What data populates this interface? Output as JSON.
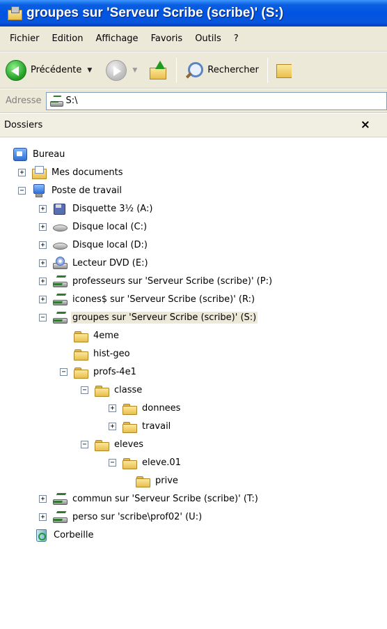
{
  "window": {
    "title": "groupes sur 'Serveur Scribe (scribe)' (S:)"
  },
  "menu": [
    "Fichier",
    "Edition",
    "Affichage",
    "Favoris",
    "Outils",
    "?"
  ],
  "toolbar": {
    "back_label": "Précédente",
    "search_label": "Rechercher"
  },
  "address": {
    "label": "Adresse",
    "value": "S:\\"
  },
  "folders_pane": {
    "title": "Dossiers",
    "close_glyph": "×"
  },
  "tree": [
    {
      "label": "Bureau",
      "icon": "desktop-icon",
      "expander": ""
    },
    {
      "label": "Mes documents",
      "icon": "my-documents-icon",
      "expander": "+"
    },
    {
      "label": "Poste de travail",
      "icon": "computer-icon",
      "expander": "−"
    },
    {
      "label": "Disquette 3½ (A:)",
      "icon": "floppy-icon",
      "expander": "+"
    },
    {
      "label": "Disque local (C:)",
      "icon": "hard-drive-icon",
      "expander": "+"
    },
    {
      "label": "Disque local (D:)",
      "icon": "hard-drive-icon",
      "expander": "+"
    },
    {
      "label": "Lecteur DVD (E:)",
      "icon": "dvd-drive-icon",
      "expander": "+"
    },
    {
      "label": "professeurs sur 'Serveur Scribe (scribe)' (P:)",
      "icon": "network-drive-icon",
      "expander": "+"
    },
    {
      "label": "icones$ sur 'Serveur Scribe (scribe)' (R:)",
      "icon": "network-drive-icon",
      "expander": "+"
    },
    {
      "label": "groupes sur 'Serveur Scribe (scribe)' (S:)",
      "icon": "network-drive-icon",
      "expander": "−"
    },
    {
      "label": "4eme",
      "icon": "folder-icon",
      "expander": ""
    },
    {
      "label": "hist-geo",
      "icon": "folder-icon",
      "expander": ""
    },
    {
      "label": "profs-4e1",
      "icon": "folder-icon",
      "expander": "−"
    },
    {
      "label": "classe",
      "icon": "folder-icon",
      "expander": "−"
    },
    {
      "label": "donnees",
      "icon": "folder-icon",
      "expander": "+"
    },
    {
      "label": "travail",
      "icon": "folder-icon",
      "expander": "+"
    },
    {
      "label": "eleves",
      "icon": "folder-icon",
      "expander": "−"
    },
    {
      "label": "eleve.01",
      "icon": "folder-icon",
      "expander": "−"
    },
    {
      "label": "prive",
      "icon": "folder-icon",
      "expander": ""
    },
    {
      "label": "commun sur 'Serveur Scribe (scribe)' (T:)",
      "icon": "network-drive-icon",
      "expander": "+"
    },
    {
      "label": "perso sur 'scribe\\prof02' (U:)",
      "icon": "network-drive-icon",
      "expander": "+"
    },
    {
      "label": "Corbeille",
      "icon": "recycle-bin-icon",
      "expander": ""
    }
  ]
}
